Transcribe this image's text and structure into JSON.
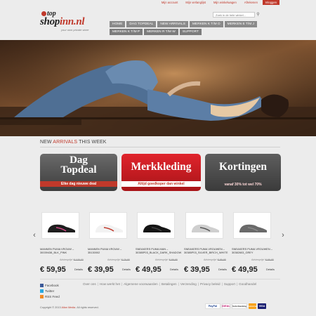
{
  "top_links": [
    "Mijn account",
    "Mijn verlanglijst",
    "Mijn winkelwagen",
    "Afrekenen",
    "Inloggen"
  ],
  "logo": {
    "line1": "top",
    "line2_a": "shop",
    "line2_b": "inn.nl",
    "slogan": "your own private store"
  },
  "search": {
    "placeholder": "Zoek in de hele winkel..."
  },
  "nav": {
    "row1": [
      "HOME",
      "DAG TOPDEAL",
      "NEW ARRIVALS",
      "MERKEN K T/M O",
      "MERKEN E T/M J"
    ],
    "row2": [
      "MERKEN K T/M P",
      "MERKEN R T/M W",
      "SUPPORT"
    ]
  },
  "section": {
    "title_a": "NEW ",
    "title_b": "ARRIVALS",
    "title_c": " THIS WEEK"
  },
  "promos": [
    {
      "title": "Dag\nTopdeal",
      "subtitle": "Elke dag nieuwe deal",
      "color": "#4a4a4a"
    },
    {
      "title": "Merkkleding",
      "subtitle": "Altijd goedkoper dan winkel",
      "color": "#d42026"
    },
    {
      "title": "Kortingen",
      "subtitle": "vanaf 30% tot wel 70%",
      "color": "#4a4a4a"
    }
  ],
  "products": [
    {
      "name": "MANNEN PUMA VROUW – 30039438_BLK_PINK",
      "adv_label": "Adviesprijs*",
      "adv_price": "€ 105,00",
      "price": "€ 59,95",
      "details": "Details",
      "shoe_color": "#1e1e1e",
      "accent": "#d64b8a"
    },
    {
      "name": "MANNEN PUMA VROUW – 35130002",
      "adv_label": "Adviesprijs*",
      "adv_price": "€ 79,95",
      "price": "€ 39,95",
      "details": "Details",
      "shoe_color": "#f2f2f2",
      "accent": "#c0392b"
    },
    {
      "name": "SNEAKERS PUMA MAN – 30385P03_BLACK_DARK_SHADOW",
      "adv_label": "Adviesprijs*",
      "adv_price": "€ 99,95",
      "price": "€ 49,95",
      "details": "Details",
      "shoe_color": "#151515",
      "accent": "#444444"
    },
    {
      "name": "SNEAKERS PUMA VROUWEN – 30385P03_SILVER_BIRCH_WHITE",
      "adv_label": "Adviesprijs*",
      "adv_price": "€ 89,95",
      "price": "€ 39,95",
      "details": "Details",
      "shoe_color": "#cfcfcf",
      "accent": "#555555"
    },
    {
      "name": "SNEAKERS PUMA VROUWEN – 30382603_GREY",
      "adv_label": "Adviesprijs*",
      "adv_price": "€ 99,95",
      "price": "€ 49,95",
      "details": "Details",
      "shoe_color": "#6a6a6a",
      "accent": "#8a8a8a"
    }
  ],
  "social": [
    {
      "label": "Facebook",
      "icon": "facebook-icon",
      "color": "#3b5998"
    },
    {
      "label": "Twitter",
      "icon": "twitter-icon",
      "color": "#29a9e0"
    },
    {
      "label": "RSS Feed",
      "icon": "rss-icon",
      "color": "#f08a24"
    }
  ],
  "footer_links": [
    "Over ons",
    "How werkt het",
    "Algemene voorwaarden",
    "Betalingen",
    "Verzending",
    "Privacy beleid",
    "Support",
    "Goodhandel"
  ],
  "copyright": {
    "text": "Copyright © 2013 ",
    "company": "Allan Media",
    "rest": ". All rights reserved."
  },
  "payment_methods": [
    "PayPal",
    "iDEAL",
    "Sofortbanking",
    "Mastercard",
    "VISA"
  ]
}
